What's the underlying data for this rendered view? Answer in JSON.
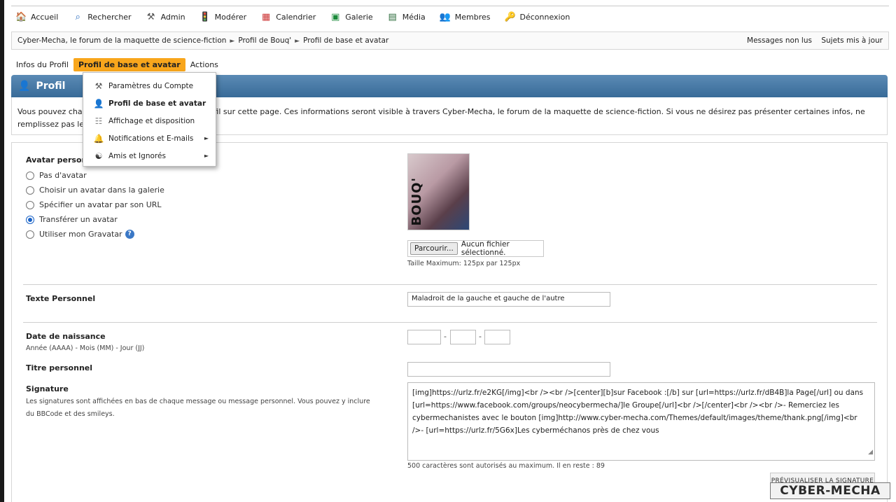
{
  "topnav": [
    {
      "label": "Accueil",
      "icon": "home-icon"
    },
    {
      "label": "Rechercher",
      "icon": "search-icon"
    },
    {
      "label": "Admin",
      "icon": "tools-icon"
    },
    {
      "label": "Modérer",
      "icon": "traffic-light-icon"
    },
    {
      "label": "Calendrier",
      "icon": "calendar-icon"
    },
    {
      "label": "Galerie",
      "icon": "gallery-icon"
    },
    {
      "label": "Média",
      "icon": "media-icon"
    },
    {
      "label": "Membres",
      "icon": "members-icon"
    },
    {
      "label": "Déconnexion",
      "icon": "logout-icon"
    }
  ],
  "breadcrumb": {
    "items": [
      "Cyber-Mecha, le forum de la maquette de science-fiction",
      "Profil de Bouq'",
      "Profil de base et avatar"
    ],
    "sep": "►",
    "unread": "Messages non lus",
    "updated": "Sujets mis à jour"
  },
  "tabs": [
    "Infos du Profil",
    "Profil de base et avatar",
    "Actions"
  ],
  "header": {
    "title": "Profil"
  },
  "intro": {
    "text": "Vous pouvez changer les informations de votre profil sur cette page. Ces informations seront visible à travers Cyber-Mecha, le forum de la maquette de science-fiction. Si vous ne désirez pas présenter certaines infos, ne remplissez pas le champ - rien n'est obligatoire."
  },
  "dropdown": [
    {
      "label": "Paramètres du Compte",
      "icon": "tools-icon"
    },
    {
      "label": "Profil de base et avatar",
      "icon": "user-icon"
    },
    {
      "label": "Affichage et disposition",
      "icon": "display-icon"
    },
    {
      "label": "Notifications et E-mails",
      "icon": "bell-icon",
      "arrow": "►"
    },
    {
      "label": "Amis et Ignorés",
      "icon": "yin-yang-icon",
      "arrow": "►"
    }
  ],
  "avatar": {
    "label": "Avatar personnel",
    "options": [
      {
        "label": "Pas d'avatar",
        "checked": false
      },
      {
        "label": "Choisir un avatar dans la galerie",
        "checked": false
      },
      {
        "label": "Spécifier un avatar par son URL",
        "checked": false
      },
      {
        "label": "Transférer un avatar",
        "checked": true
      },
      {
        "label": "Utiliser mon Gravatar",
        "checked": false
      }
    ],
    "image_text": "BOUQ'",
    "file_button": "Parcourir...",
    "file_status": "Aucun fichier sélectionné.",
    "max_size": "Taille Maximum: 125px par 125px"
  },
  "personal_text": {
    "label": "Texte Personnel",
    "value": "Maladroit de la gauche et gauche de l'autre"
  },
  "birthdate": {
    "label": "Date de naissance",
    "hint": "Année (AAAA) - Mois (MM) - Jour (JJ)",
    "sep": "-"
  },
  "personal_title": {
    "label": "Titre personnel",
    "value": ""
  },
  "signature": {
    "label": "Signature",
    "hint": "Les signatures sont affichées en bas de chaque message ou message personnel. Vous pouvez y inclure du BBCode et des smileys.",
    "value": "[img]https://urlz.fr/e2KG[/img]<br /><br />[center][b]sur Facebook :[/b] sur [url=https://urlz.fr/dB4B]la Page[/url] ou dans [url=https://www.facebook.com/groups/neocybermecha/]le Groupe[/url]<br />[/center]<br /><br />- Remerciez les cybermechanistes avec le bouton [img]http://www.cyber-mecha.com/Themes/default/images/theme/thank.png[/img]<br />- [url=https://urlz.fr/5G6x]Les cyberméchanos près de chez vous",
    "remaining": "500 caractères sont autorisés au maximum. Il en reste : 89",
    "preview_button": "PRÉVISUALISER LA SIGNATURE"
  },
  "watermark": "CYBER-MECHA"
}
